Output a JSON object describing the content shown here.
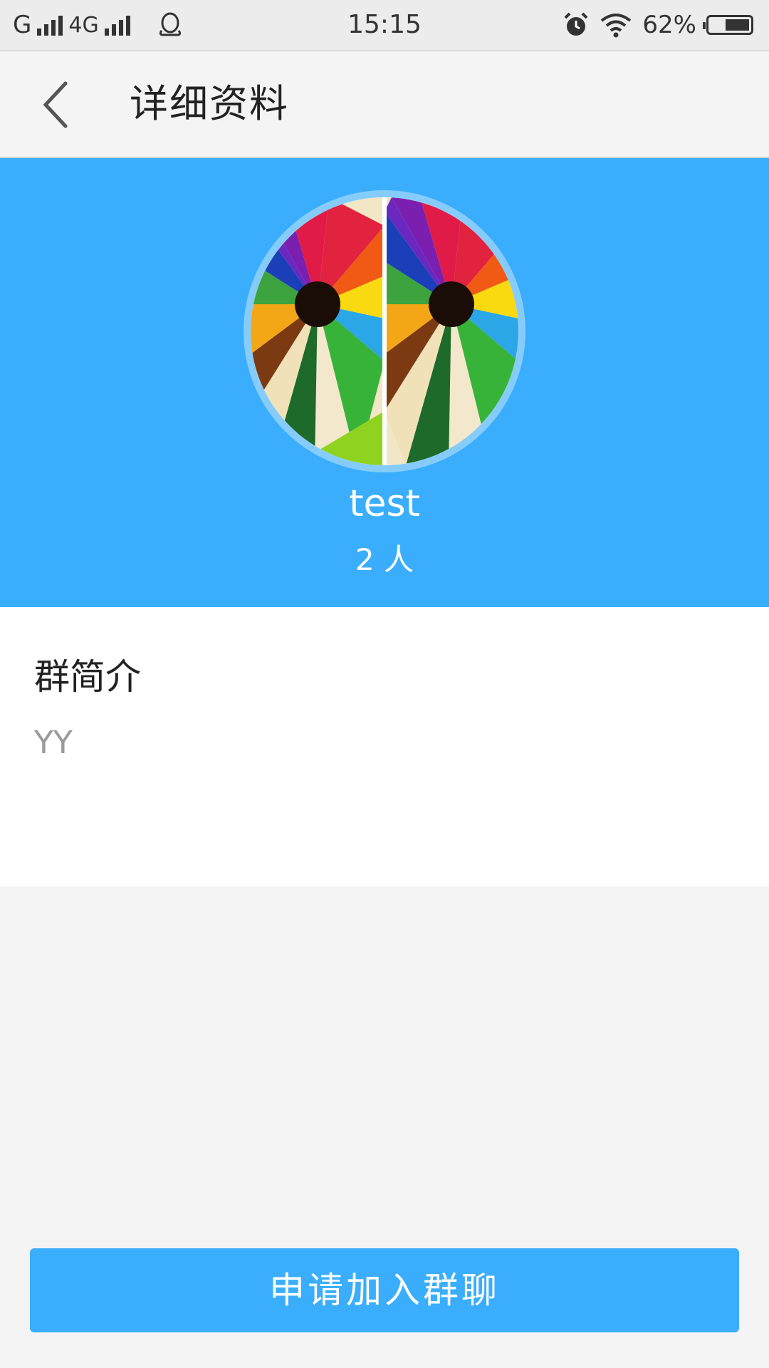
{
  "status_bar": {
    "carrier1": "G",
    "carrier2": "4G",
    "time": "15:15",
    "battery": "62%",
    "battery_level": 0.62,
    "icons": [
      "signal-icon",
      "qq-icon",
      "alarm-icon",
      "wifi-icon",
      "battery-icon"
    ]
  },
  "header": {
    "title": "详细资料",
    "back_icon": "chevron-left-icon"
  },
  "group": {
    "name": "test",
    "members": "2 人",
    "avatar": "colored-pencils-avatar"
  },
  "intro": {
    "title": "群简介",
    "text": "YY"
  },
  "actions": {
    "join_label": "申请加入群聊"
  },
  "colors": {
    "accent": "#3aaefd",
    "avatar_ring": "#86ccfb",
    "background": "#f4f4f4"
  }
}
